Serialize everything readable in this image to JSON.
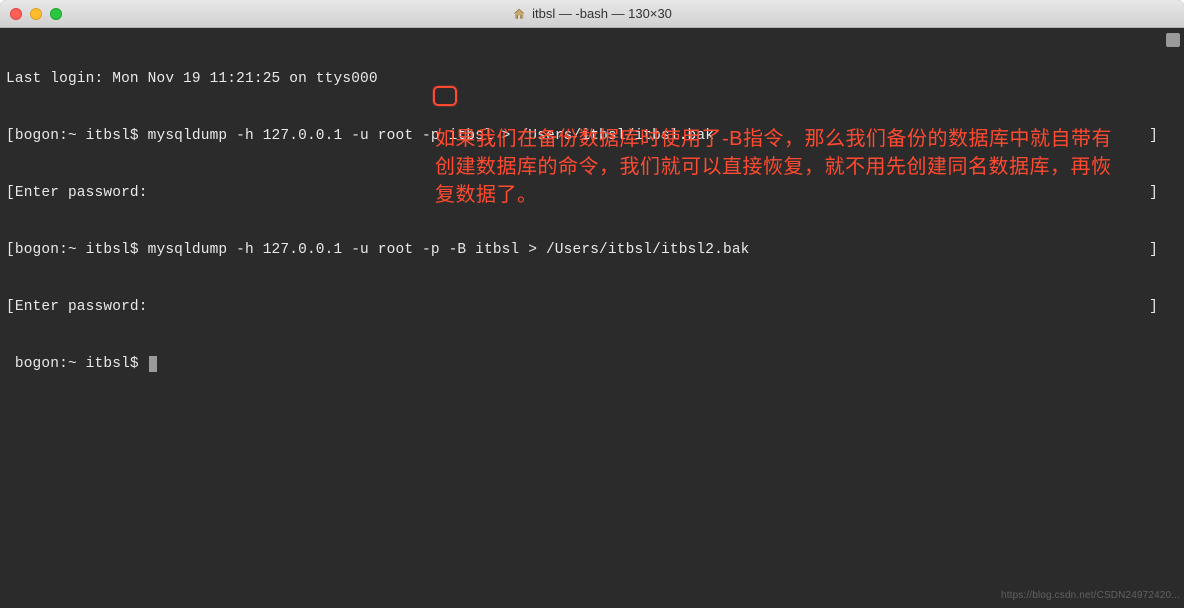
{
  "titlebar": {
    "title": "itbsl — -bash — 130×30"
  },
  "terminal": {
    "lines": {
      "lastlogin": "Last login: Mon Nov 19 11:21:25 on ttys000",
      "prompt1_prefix": "[bogon:~ itbsl$ ",
      "cmd1": "mysqldump -h 127.0.0.1 -u root -p itbsl > /Users/itbsl/itbsl.bak",
      "enter1": "[Enter password:",
      "prompt2_prefix": "[bogon:~ itbsl$ ",
      "cmd2_before": "mysqldump -h 127.0.0.1 -u root -p ",
      "cmd2_flag": "-B",
      "cmd2_after": " itbsl > /Users/itbsl/itbsl2.bak",
      "enter2": "[Enter password:",
      "prompt3": " bogon:~ itbsl$ "
    },
    "bracket_right": "]"
  },
  "annotation": {
    "text": "如果我们在备份数据库时使用了-B指令，那么我们备份的数据库中就自带有创建数据库的命令，我们就可以直接恢复，就不用先创建同名数据库，再恢复数据了。"
  },
  "watermark": "https://blog.csdn.net/CSDN24972420..."
}
